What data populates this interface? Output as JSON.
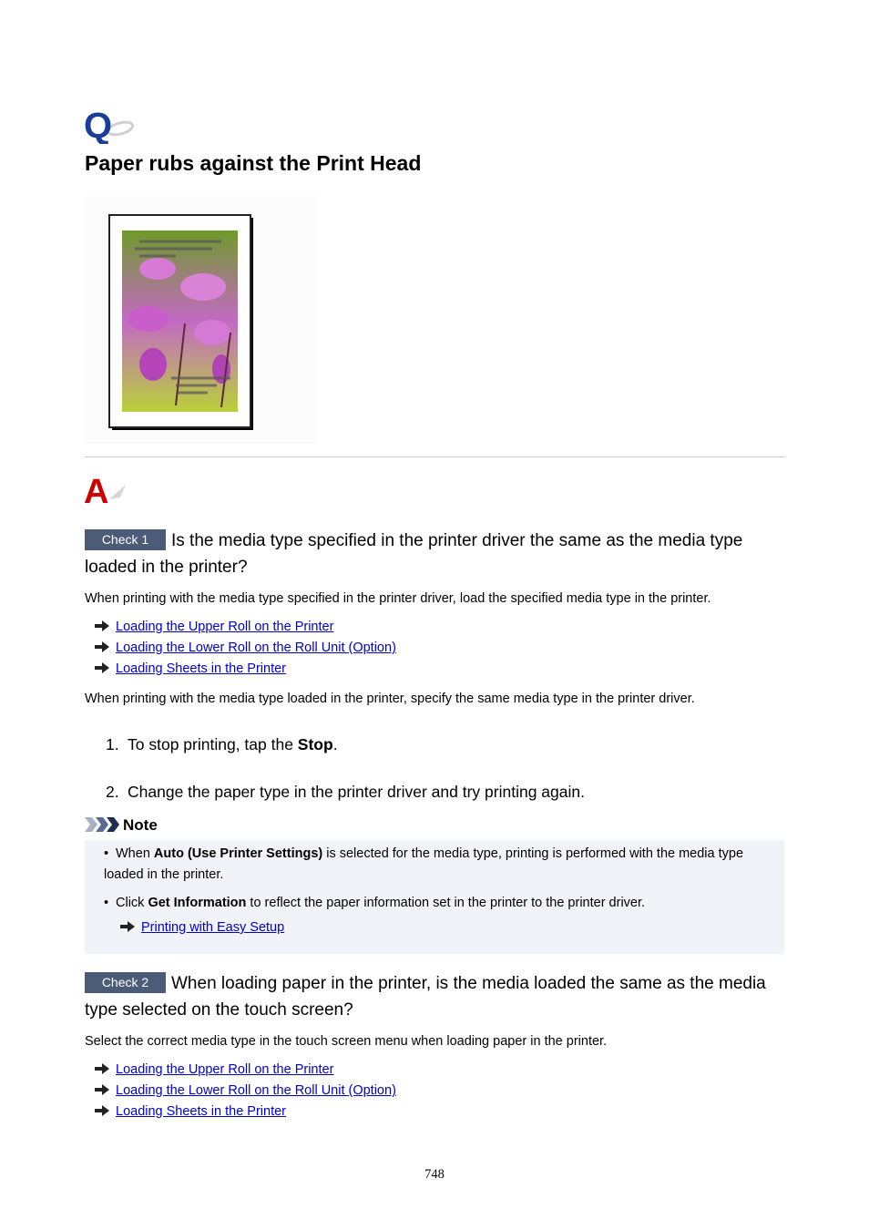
{
  "header": {
    "q_icon": "question-q-icon",
    "title": "Paper rubs against the Print Head",
    "illustration": "printed-flower-photo-with-rub-marks"
  },
  "answer_icon": "answer-a-icon",
  "checks": [
    {
      "badge": "Check 1",
      "question": "Is the media type specified in the printer driver the same as the media type loaded in the printer?",
      "intro": "When printing with the media type specified in the printer driver, load the specified media type in the printer.",
      "links": [
        "Loading the Upper Roll on the Printer",
        "Loading the Lower Roll on the Roll Unit (Option)",
        "Loading Sheets in the Printer"
      ],
      "followup": "When printing with the media type loaded in the printer, specify the same media type in the printer driver.",
      "steps": [
        {
          "num": "1.",
          "pre": "To stop printing, tap the ",
          "bold": "Stop",
          "post": "."
        },
        {
          "num": "2.",
          "pre": "Change the paper type in the printer driver and try printing again.",
          "bold": "",
          "post": ""
        }
      ],
      "note": {
        "title": "Note",
        "items": [
          {
            "pre": "When ",
            "bold": "Auto (Use Printer Settings)",
            "post": " is selected for the media type, printing is performed with the media type loaded in the printer."
          },
          {
            "pre": "Click ",
            "bold": "Get Information",
            "post": " to reflect the paper information set in the printer to the printer driver."
          }
        ],
        "link": "Printing with Easy Setup"
      }
    },
    {
      "badge": "Check 2",
      "question": "When loading paper in the printer, is the media loaded the same as the media type selected on the touch screen?",
      "intro": "Select the correct media type in the touch screen menu when loading paper in the printer.",
      "links": [
        "Loading the Upper Roll on the Printer",
        "Loading the Lower Roll on the Roll Unit (Option)",
        "Loading Sheets in the Printer"
      ]
    }
  ],
  "footer": {
    "page_number": "748"
  },
  "colors": {
    "badge": "#4b5b78",
    "link": "#0000cc",
    "q_blue": "#1a3d99",
    "a_red": "#cc0000",
    "note_bg": "#f2f3f9"
  }
}
